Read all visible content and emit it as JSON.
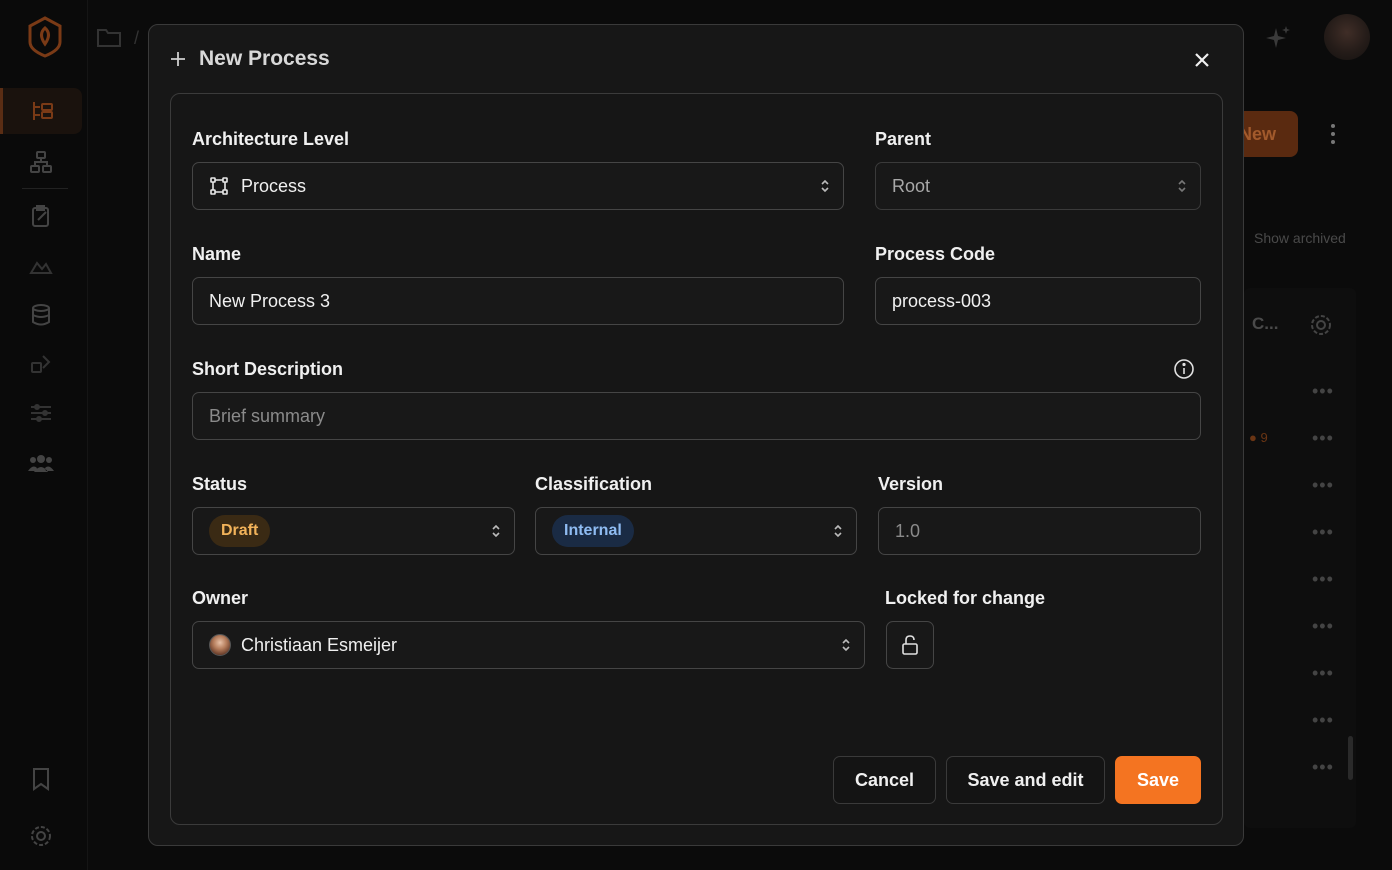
{
  "background": {
    "breadcrumb_separator": "/",
    "new_button_label": "New",
    "show_archived_label": "Show archived",
    "column_header_truncated": "C...",
    "badge_count": "9"
  },
  "modal": {
    "title": "New Process",
    "fields": {
      "architecture_level": {
        "label": "Architecture Level",
        "value": "Process",
        "icon": "process-icon"
      },
      "parent": {
        "label": "Parent",
        "value": "Root"
      },
      "name": {
        "label": "Name",
        "value": "New Process 3"
      },
      "process_code": {
        "label": "Process Code",
        "value": "process-003"
      },
      "short_description": {
        "label": "Short Description",
        "placeholder": "Brief summary"
      },
      "status": {
        "label": "Status",
        "value": "Draft"
      },
      "classification": {
        "label": "Classification",
        "value": "Internal"
      },
      "version": {
        "label": "Version",
        "placeholder": "1.0"
      },
      "owner": {
        "label": "Owner",
        "value": "Christiaan Esmeijer"
      },
      "locked_for_change": {
        "label": "Locked for change",
        "locked": false
      }
    },
    "actions": {
      "cancel": "Cancel",
      "save_and_edit": "Save and edit",
      "save": "Save"
    }
  },
  "colors": {
    "accent": "#f47421",
    "draft_badge_text": "#f2b35a",
    "internal_badge_text": "#8fbcf2"
  }
}
